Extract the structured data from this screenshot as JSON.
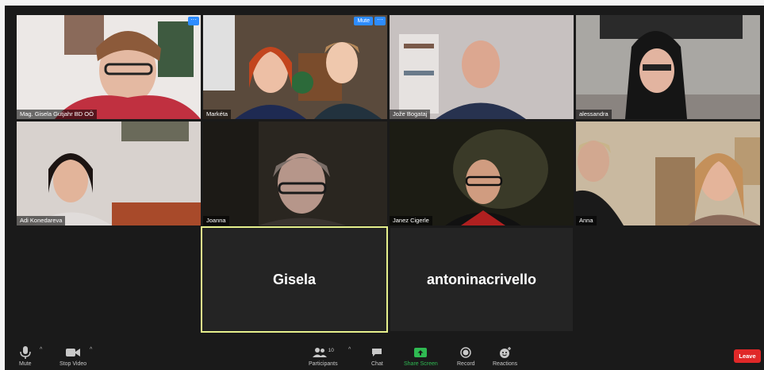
{
  "colors": {
    "accent": "#2d8cff",
    "active_speaker": "#e6f08c",
    "leave": "#e02828",
    "share_green": "#2fba52"
  },
  "tiles": [
    {
      "name": "Mag. Gisela Gutjahr BD OÖ",
      "more": "···"
    },
    {
      "name": "Markéta",
      "mute": "Mute",
      "more": "···"
    },
    {
      "name": "Jože Bogataj"
    },
    {
      "name": "alessandra"
    },
    {
      "name": "Adi Konedareva"
    },
    {
      "name": "Joanna"
    },
    {
      "name": "Janez Cigerle"
    },
    {
      "name": "Anna"
    }
  ],
  "name_tiles": [
    {
      "name": "Gisela"
    },
    {
      "name": "antoninacrivello"
    }
  ],
  "toolbar": {
    "mute": "Mute",
    "stop_video": "Stop Video",
    "participants": "Participants",
    "participants_count": "10",
    "chat": "Chat",
    "share_screen": "Share Screen",
    "record": "Record",
    "reactions": "Reactions",
    "leave": "Leave"
  },
  "icons": [
    "microphone-icon",
    "video-camera-icon",
    "participants-icon",
    "chat-icon",
    "share-screen-icon",
    "record-icon",
    "reactions-icon",
    "caret-up-icon",
    "more-options-icon"
  ]
}
